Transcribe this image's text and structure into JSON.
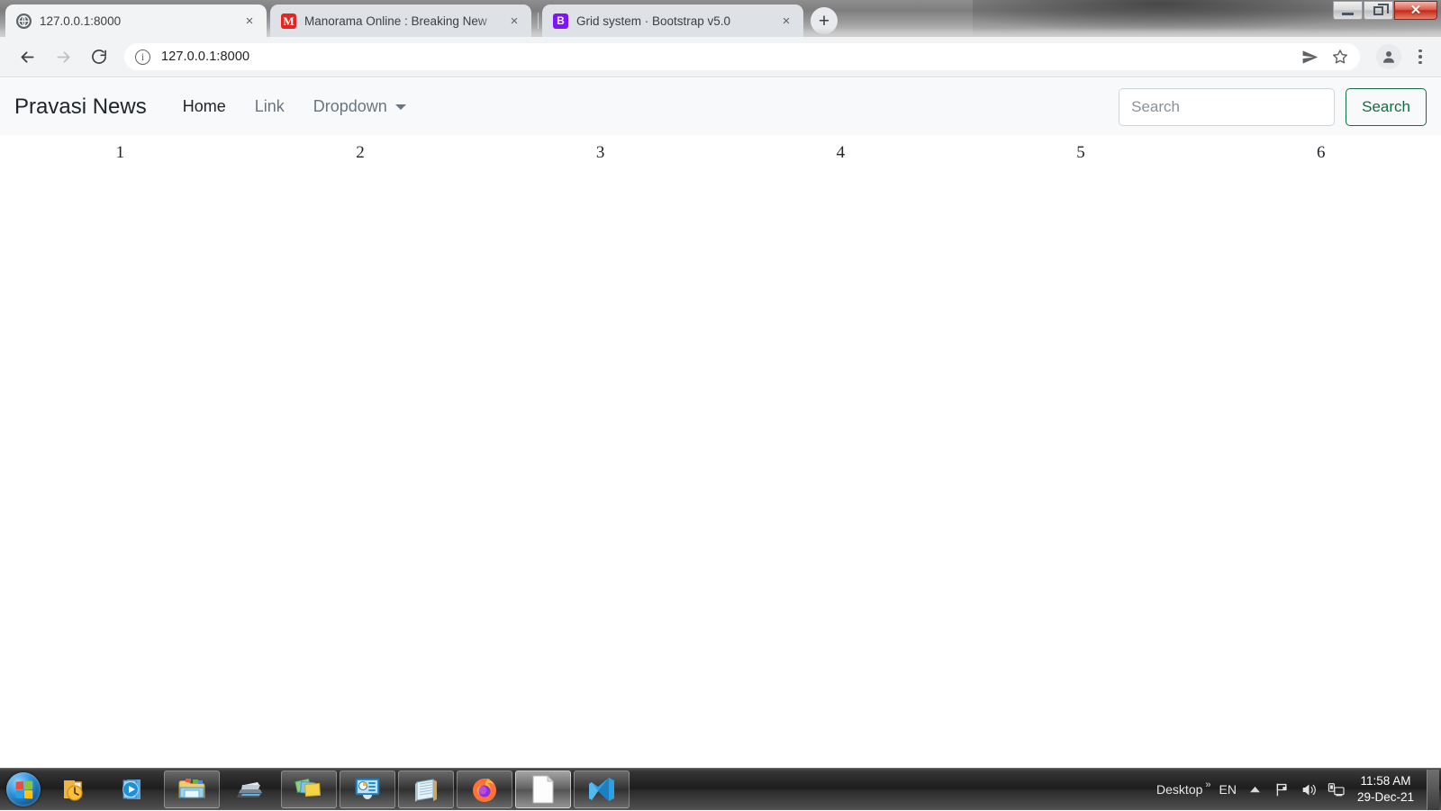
{
  "browser": {
    "tabs": [
      {
        "title": "127.0.0.1:8000",
        "favicon": "globe-icon",
        "favicon_letter": "",
        "active": true
      },
      {
        "title": "Manorama Online : Breaking New",
        "favicon": "manorama-icon",
        "favicon_letter": "M",
        "active": false
      },
      {
        "title": "Grid system · Bootstrap v5.0",
        "favicon": "bootstrap-icon",
        "favicon_letter": "B",
        "active": false
      }
    ],
    "tab_close_label": "×",
    "new_tab_label": "+",
    "window_controls": {
      "minimize": "minimize-icon",
      "restore": "restore-icon",
      "close": "✕"
    },
    "toolbar": {
      "back": "back-arrow-icon",
      "forward": "forward-arrow-icon",
      "reload": "reload-icon",
      "site_info": "i",
      "url": "127.0.0.1:8000",
      "share": "send-icon",
      "bookmark": "star-icon",
      "profile": "profile-avatar-icon",
      "menu": "three-dot-menu-icon"
    }
  },
  "page": {
    "navbar": {
      "brand": "Pravasi News",
      "links": [
        {
          "label": "Home",
          "state": "active"
        },
        {
          "label": "Link",
          "state": "muted"
        }
      ],
      "dropdown": {
        "label": "Dropdown",
        "caret": "chevron-down-icon"
      },
      "search": {
        "placeholder": "Search",
        "value": "",
        "button_label": "Search",
        "button_color": "#146c43"
      },
      "background": "#f8f9fa"
    },
    "grid": {
      "columns": [
        "1",
        "2",
        "3",
        "4",
        "5",
        "6"
      ]
    }
  },
  "taskbar": {
    "start": "windows-start-orb-icon",
    "items": [
      {
        "name": "outlook-icon",
        "state": "pinned"
      },
      {
        "name": "media-player-icon",
        "state": "pinned"
      },
      {
        "name": "file-explorer-icon",
        "state": "running"
      },
      {
        "name": "scanner-icon",
        "state": "pinned"
      },
      {
        "name": "pictures-icon",
        "state": "running"
      },
      {
        "name": "powerpoint-icon",
        "state": "running"
      },
      {
        "name": "notepad-icon",
        "state": "running"
      },
      {
        "name": "firefox-icon",
        "state": "running"
      },
      {
        "name": "document-icon",
        "state": "active"
      },
      {
        "name": "vscode-icon",
        "state": "running"
      }
    ],
    "tray": {
      "desktop_label": "Desktop",
      "overflow": "»",
      "language": "EN",
      "show_hidden": "show-hidden-icons-icon",
      "action_center": "flag-icon",
      "volume": "speaker-icon",
      "network": "network-icon",
      "time": "11:58 AM",
      "date": "29-Dec-21"
    }
  }
}
